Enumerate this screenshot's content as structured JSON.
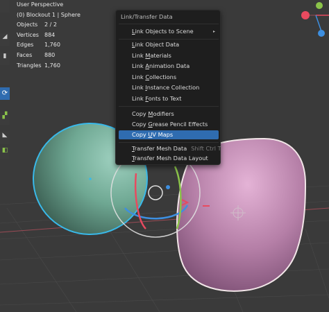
{
  "viewport": {
    "view_name": "User Perspective",
    "collection": "(0) Blockout 1 | Sphere"
  },
  "stats": [
    {
      "label": "Objects",
      "value": "2 / 2"
    },
    {
      "label": "Vertices",
      "value": "884"
    },
    {
      "label": "Edges",
      "value": "1,760"
    },
    {
      "label": "Faces",
      "value": "880"
    },
    {
      "label": "Triangles",
      "value": "1,760"
    }
  ],
  "menu": {
    "title": "Link/Transfer Data",
    "items": [
      {
        "pre": "",
        "u": "L",
        "post": "ink Objects to Scene",
        "has_submenu": true
      },
      {
        "pre": "",
        "u": "L",
        "post": "ink Object Data"
      },
      {
        "pre": "Link ",
        "u": "M",
        "post": "aterials"
      },
      {
        "pre": "Link ",
        "u": "A",
        "post": "nimation Data"
      },
      {
        "pre": "Link ",
        "u": "C",
        "post": "ollections"
      },
      {
        "pre": "Link ",
        "u": "I",
        "post": "nstance Collection"
      },
      {
        "pre": "Link ",
        "u": "F",
        "post": "onts to Text"
      },
      {
        "pre": "Copy ",
        "u": "M",
        "post": "odifiers"
      },
      {
        "pre": "Copy ",
        "u": "G",
        "post": "rease Pencil Effects"
      },
      {
        "pre": "Copy ",
        "u": "U",
        "post": "V Maps"
      },
      {
        "pre": "",
        "u": "T",
        "post": "ransfer Mesh Data",
        "shortcut": "Shift Ctrl T"
      },
      {
        "pre": "",
        "u": "T",
        "post": "ransfer Mesh Data Layout"
      }
    ]
  },
  "colors": {
    "highlight": "#2f6cb0",
    "selected_outline": "#39b9ea",
    "active_outline": "#f2e6e8",
    "sphere": "#6fa893",
    "blob": "#b57fa7",
    "axis_x": "#e84a5f",
    "axis_y": "#8bc34a",
    "axis_z": "#3d8fe0"
  }
}
